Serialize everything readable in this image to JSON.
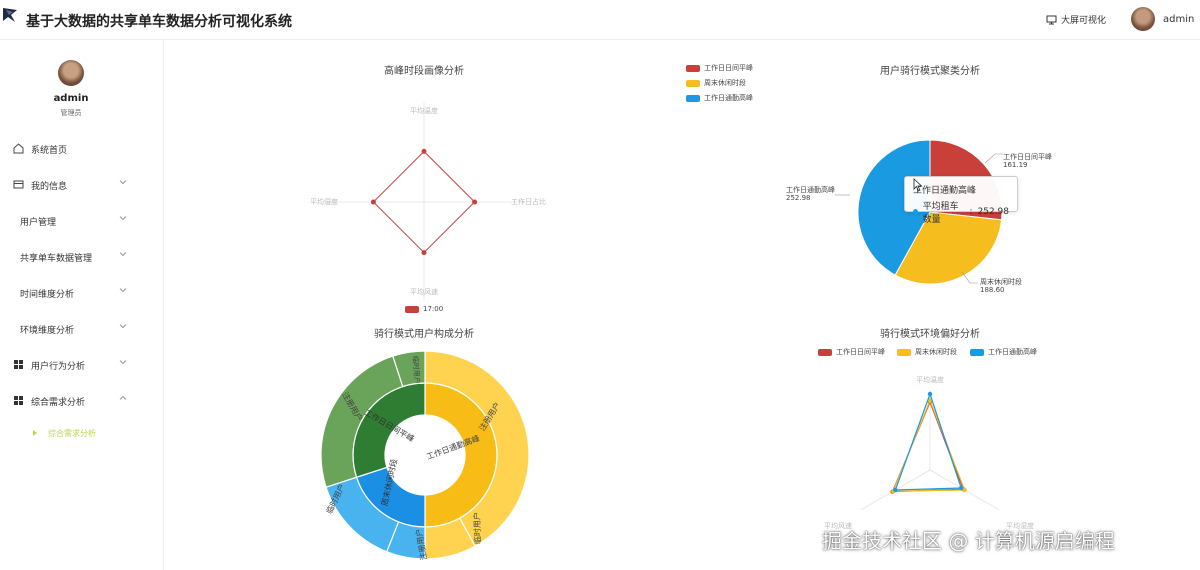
{
  "header": {
    "title": "基于大数据的共享单车数据分析可视化系统",
    "bigscreen_label": "大屏可视化",
    "user_name": "admin"
  },
  "sidebar": {
    "user_name": "admin",
    "role": "管理员",
    "items": [
      {
        "label": "系统首页",
        "icon": "home-icon"
      },
      {
        "label": "我的信息",
        "icon": "id-card-icon"
      },
      {
        "label": "用户管理"
      },
      {
        "label": "共享单车数据管理"
      },
      {
        "label": "时间维度分析"
      },
      {
        "label": "环境维度分析"
      },
      {
        "label": "用户行为分析",
        "icon": "grid-icon"
      },
      {
        "label": "综合需求分析",
        "icon": "grid-icon"
      },
      {
        "label": "综合需求分析"
      }
    ]
  },
  "colors": {
    "red": "#c9403b",
    "yellow": "#f5bd1e",
    "blue": "#1a9ae1",
    "green": "#2e7d32",
    "active": "#b7d94a"
  },
  "legend_top": [
    "工作日日间平峰",
    "周末休闲时段",
    "工作日通勤高峰"
  ],
  "charts": {
    "radar_peak": {
      "title": "高峰时段画像分析",
      "axes": [
        "平均温度",
        "工作日占比",
        "平均风速",
        "平均湿度"
      ],
      "legend": "17:00"
    },
    "pie_cluster": {
      "title": "用户骑行模式聚类分析",
      "labels": [
        {
          "name": "工作日日间平峰",
          "value": "161.19"
        },
        {
          "name": "工作日通勤高峰",
          "value": "252.98"
        },
        {
          "name": "周末休闲时段",
          "value": "188.60"
        }
      ],
      "tooltip": {
        "title": "工作日通勤高峰",
        "series": "平均租车数量",
        "value": "252.98"
      }
    },
    "sunburst": {
      "title": "骑行模式用户构成分析",
      "inner": [
        "工作日通勤高峰",
        "周末休闲时段",
        "工作日日间平峰"
      ],
      "outer": [
        "注册用户",
        "临时用户",
        "注册用户",
        "临时用户",
        "注册用户",
        "临时用户"
      ]
    },
    "radar_env": {
      "title": "骑行模式环境偏好分析",
      "legend": [
        "工作日日间平峰",
        "周末休闲时段",
        "工作日通勤高峰"
      ],
      "axes": [
        "平均温度",
        "平均湿度",
        "平均风速"
      ]
    }
  },
  "chart_data": [
    {
      "type": "radar",
      "title": "高峰时段画像分析",
      "indicators": [
        "平均温度",
        "工作日占比",
        "平均风速",
        "平均湿度"
      ],
      "series": [
        {
          "name": "17:00",
          "values": [
            0.55,
            0.55,
            0.55,
            0.55
          ]
        }
      ]
    },
    {
      "type": "pie",
      "title": "用户骑行模式聚类分析",
      "categories": [
        "工作日日间平峰",
        "周末休闲时段",
        "工作日通勤高峰"
      ],
      "values": [
        161.19,
        188.6,
        252.98
      ]
    },
    {
      "type": "sunburst",
      "title": "骑行模式用户构成分析",
      "inner": {
        "categories": [
          "工作日通勤高峰",
          "周末休闲时段",
          "工作日日间平峰"
        ],
        "values": [
          0.5,
          0.2,
          0.3
        ]
      },
      "outer": {
        "categories": [
          "注册用户",
          "临时用户",
          "注册用户",
          "临时用户",
          "注册用户",
          "临时用户"
        ],
        "values": [
          0.42,
          0.08,
          0.06,
          0.14,
          0.25,
          0.05
        ]
      }
    },
    {
      "type": "radar",
      "title": "骑行模式环境偏好分析",
      "indicators": [
        "平均温度",
        "平均湿度",
        "平均风速"
      ],
      "series": [
        {
          "name": "工作日日间平峰",
          "values": [
            0.85,
            0.48,
            0.54
          ]
        },
        {
          "name": "周末休闲时段",
          "values": [
            0.87,
            0.5,
            0.53
          ]
        },
        {
          "name": "工作日通勤高峰",
          "values": [
            0.95,
            0.45,
            0.5
          ]
        }
      ]
    }
  ],
  "watermark": "掘金技术社区 @ 计算机源启编程"
}
